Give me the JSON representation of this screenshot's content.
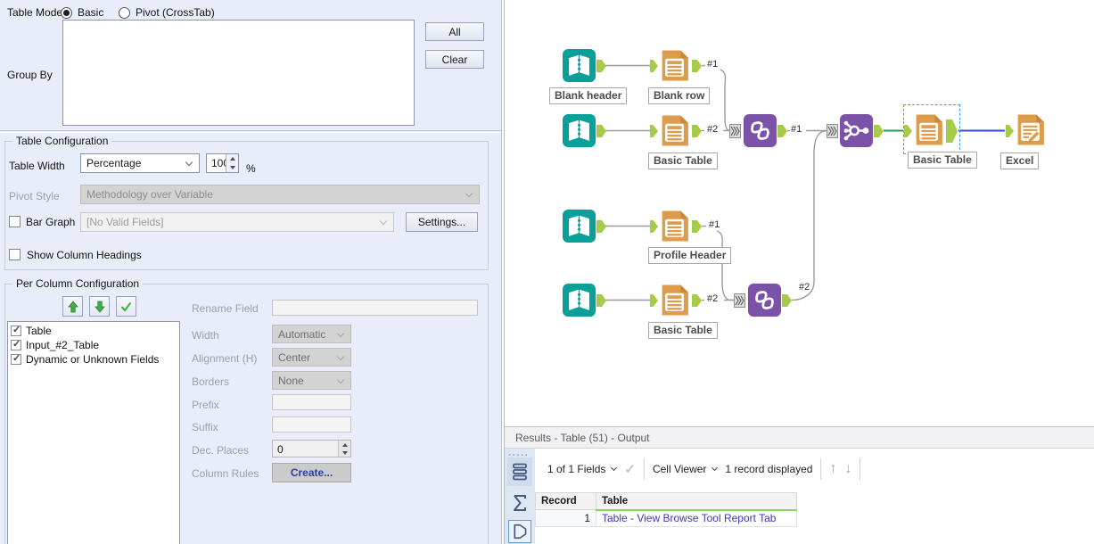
{
  "config_panel": {
    "table_mode": {
      "label": "Table Mode",
      "options": [
        {
          "label": "Basic",
          "selected": true
        },
        {
          "label": "Pivot (CrossTab)",
          "selected": false
        }
      ]
    },
    "group_by": {
      "label": "Group By",
      "all_button": "All",
      "clear_button": "Clear"
    },
    "table_configuration": {
      "title": "Table Configuration",
      "table_width": {
        "label": "Table Width",
        "value": "Percentage",
        "amount": "100",
        "unit": "%"
      },
      "pivot_style": {
        "label": "Pivot Style",
        "value": "Methodology over Variable"
      },
      "bar_graph": {
        "label": "Bar Graph",
        "checked": false,
        "value": "[No Valid Fields]",
        "settings_button": "Settings..."
      },
      "show_column_headings": {
        "label": "Show Column Headings",
        "checked": false
      }
    },
    "per_column_configuration": {
      "title": "Per Column Configuration",
      "columns": [
        {
          "label": "Table",
          "checked": true
        },
        {
          "label": "Input_#2_Table",
          "checked": true
        },
        {
          "label": "Dynamic or Unknown Fields",
          "checked": true
        }
      ],
      "fields": {
        "rename_field": {
          "label": "Rename Field",
          "value": ""
        },
        "width": {
          "label": "Width",
          "value": "Automatic"
        },
        "alignment": {
          "label": "Alignment (H)",
          "value": "Center"
        },
        "borders": {
          "label": "Borders",
          "value": "None"
        },
        "prefix": {
          "label": "Prefix",
          "value": ""
        },
        "suffix": {
          "label": "Suffix",
          "value": ""
        },
        "dec_places": {
          "label": "Dec. Places",
          "value": "0"
        },
        "column_rules": {
          "label": "Column Rules",
          "create_button": "Create..."
        }
      }
    }
  },
  "canvas": {
    "tools": [
      "text-input",
      "table",
      "text-input",
      "table",
      "union",
      "join-multiple",
      "table",
      "render",
      "text-input",
      "table",
      "text-input",
      "table",
      "union"
    ],
    "annotations": [
      "Blank header",
      "Blank row",
      "Basic Table",
      "Profile Header",
      "Basic Table",
      "Basic Table",
      "Excel"
    ],
    "port_tags": [
      "#1",
      "#2",
      "#1",
      "#1",
      "#2",
      "#2"
    ],
    "wire_colors": {
      "default": "#9b9b9b",
      "highlight_green": "#22a14e",
      "highlight_blue": "#3347e0"
    },
    "tool_colors": {
      "teal": "#0aa09a",
      "orange": "#dd9c4b",
      "purple": "#7b52a8",
      "anchor_green": "#a6cb48"
    }
  },
  "results": {
    "title": "Results - Table (51) - Output",
    "toolbar": {
      "fields_dropdown": "1 of 1 Fields",
      "cell_viewer_dropdown": "Cell Viewer",
      "record_count": "1 record displayed"
    },
    "grid": {
      "columns": [
        "Record",
        "Table"
      ],
      "rows": [
        {
          "record": "1",
          "table": "Table - View Browse Tool Report Tab"
        }
      ]
    }
  }
}
